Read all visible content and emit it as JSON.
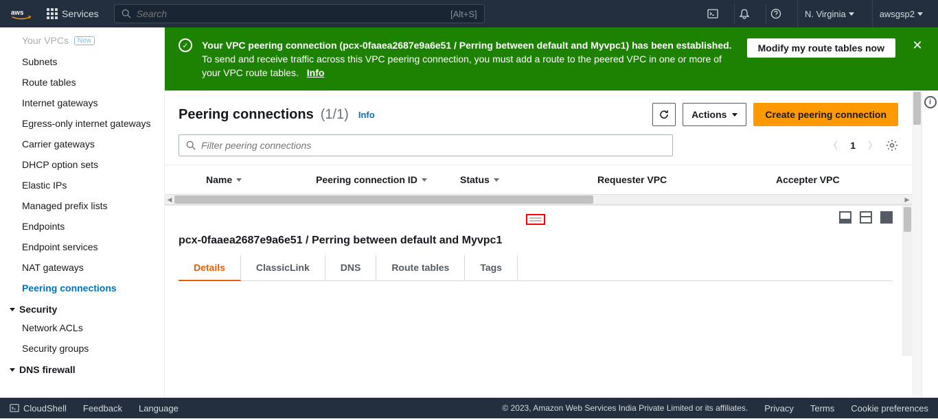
{
  "topnav": {
    "services_label": "Services",
    "search_placeholder": "Search",
    "search_shortcut": "[Alt+S]",
    "region": "N. Virginia",
    "account": "awsgsp2"
  },
  "sidebar": {
    "items": [
      {
        "label": "Your VPCs",
        "badge": "New",
        "dim": true
      },
      {
        "label": "Subnets"
      },
      {
        "label": "Route tables"
      },
      {
        "label": "Internet gateways"
      },
      {
        "label": "Egress-only internet gateways"
      },
      {
        "label": "Carrier gateways"
      },
      {
        "label": "DHCP option sets"
      },
      {
        "label": "Elastic IPs"
      },
      {
        "label": "Managed prefix lists"
      },
      {
        "label": "Endpoints"
      },
      {
        "label": "Endpoint services"
      },
      {
        "label": "NAT gateways"
      },
      {
        "label": "Peering connections",
        "active": true
      }
    ],
    "sections": [
      {
        "title": "Security",
        "items": [
          "Network ACLs",
          "Security groups"
        ]
      },
      {
        "title": "DNS firewall",
        "items": []
      }
    ]
  },
  "alert": {
    "line1_bold": "Your VPC peering connection (pcx-0faaea2687e9a6e51 / Perring between default and Myvpc1) has been established.",
    "line2": "To send and receive traffic across this VPC peering connection, you must add a route to the peered VPC in one or more of your VPC route tables.",
    "info_label": "Info",
    "button": "Modify my route tables now"
  },
  "page": {
    "title": "Peering connections",
    "count": "(1/1)",
    "info_label": "Info",
    "actions_label": "Actions",
    "create_label": "Create peering connection",
    "filter_placeholder": "Filter peering connections",
    "page_current": "1"
  },
  "table": {
    "columns": [
      "Name",
      "Peering connection ID",
      "Status",
      "Requester VPC",
      "Accepter VPC"
    ]
  },
  "detail": {
    "title": "pcx-0faaea2687e9a6e51 / Perring between default and Myvpc1",
    "tabs": [
      "Details",
      "ClassicLink",
      "DNS",
      "Route tables",
      "Tags"
    ]
  },
  "bottom": {
    "cloudshell": "CloudShell",
    "feedback": "Feedback",
    "language": "Language",
    "copyright": "© 2023, Amazon Web Services India Private Limited or its affiliates.",
    "links": [
      "Privacy",
      "Terms",
      "Cookie preferences"
    ]
  }
}
